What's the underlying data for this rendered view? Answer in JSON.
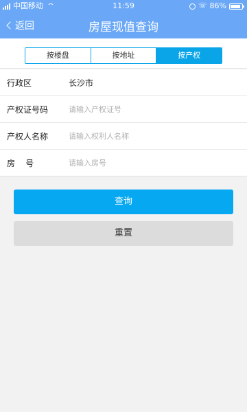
{
  "status_bar": {
    "carrier": "中国移动",
    "time": "11:59",
    "battery": "86%",
    "battery_level": 0.86
  },
  "header": {
    "back_label": "返回",
    "title": "房屋现值查询"
  },
  "tabs": [
    {
      "label": "按楼盘",
      "active": false
    },
    {
      "label": "按地址",
      "active": false
    },
    {
      "label": "按产权",
      "active": true
    }
  ],
  "form": {
    "district": {
      "label": "行政区",
      "value": "长沙市"
    },
    "cert_no": {
      "label": "产权证号码",
      "placeholder": "请输入产权证号"
    },
    "owner": {
      "label": "产权人名称",
      "placeholder": "请输入权利人名称"
    },
    "room_no": {
      "label": "房    号",
      "placeholder": "请输入房号"
    }
  },
  "buttons": {
    "query": "查询",
    "reset": "重置"
  },
  "colors": {
    "header_bg": "#6aa8f7",
    "accent": "#0aa5e8",
    "query_btn": "#06a8f2",
    "reset_btn": "#dcdcdc"
  }
}
